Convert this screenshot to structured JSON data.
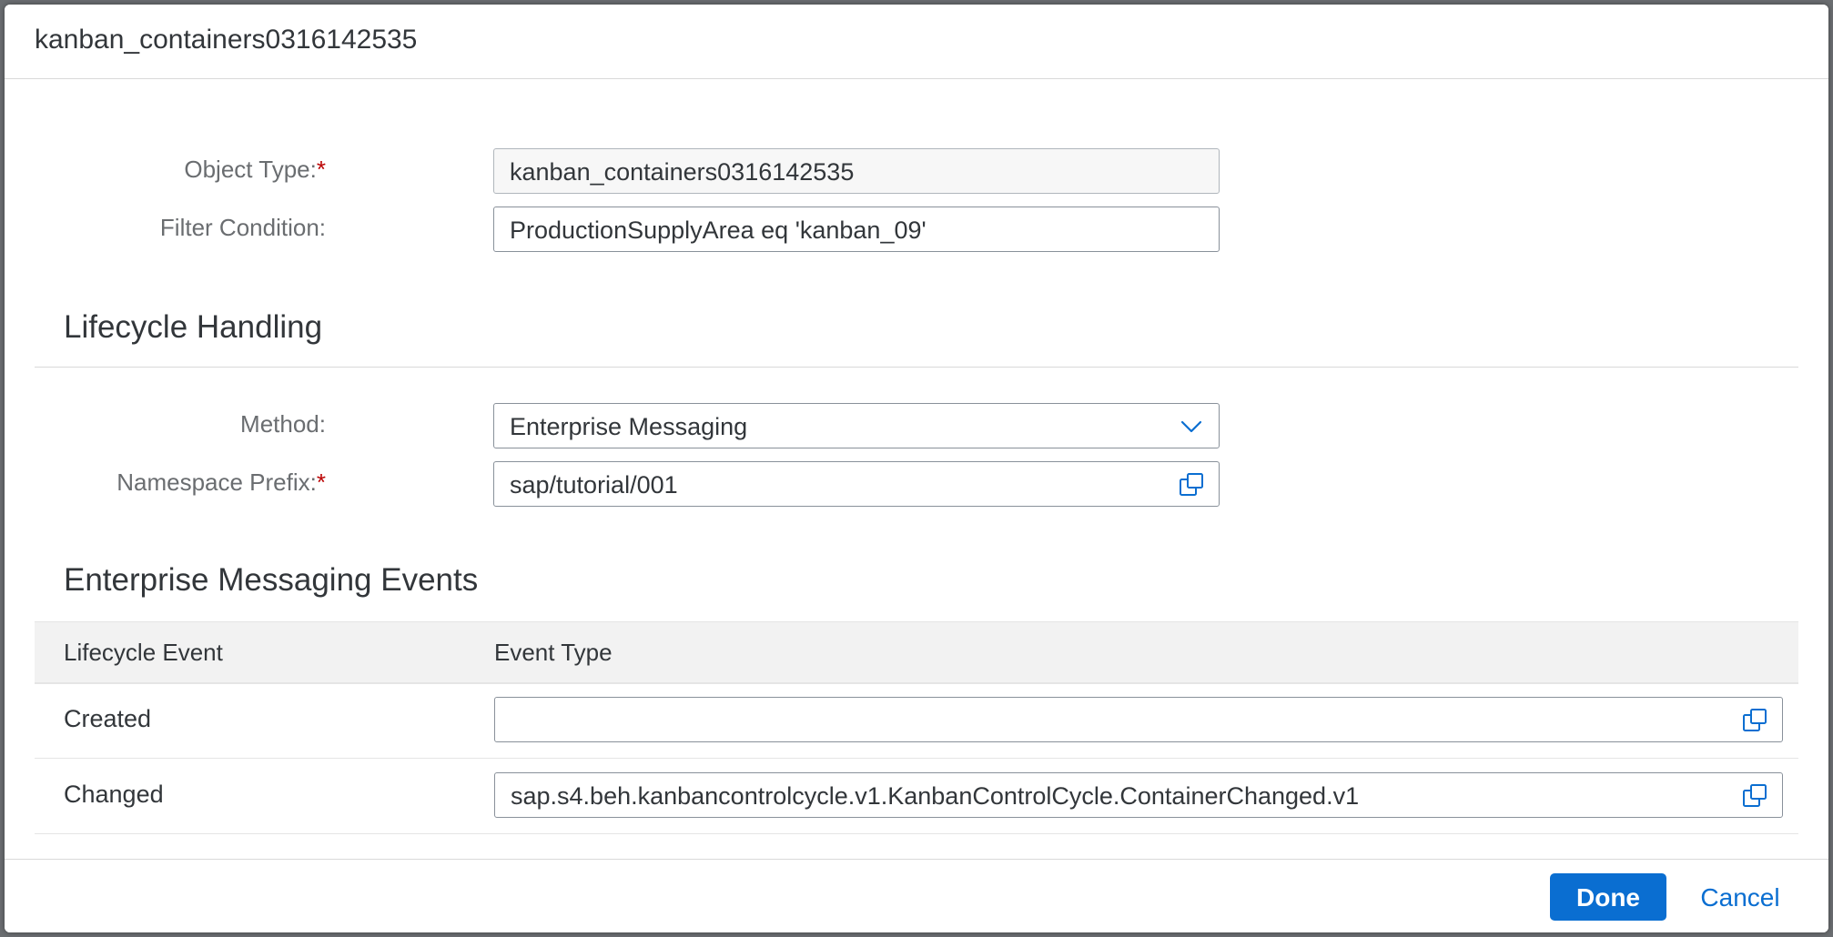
{
  "dialog": {
    "title": "kanban_containers0316142535"
  },
  "form": {
    "object_type_label": "Object Type:",
    "object_type_value": "kanban_containers0316142535",
    "filter_condition_label": "Filter Condition:",
    "filter_condition_value": "ProductionSupplyArea eq 'kanban_09'",
    "required_marker": "*"
  },
  "lifecycle": {
    "section_title": "Lifecycle Handling",
    "method_label": "Method:",
    "method_value": "Enterprise Messaging",
    "namespace_label": "Namespace Prefix:",
    "namespace_value": "sap/tutorial/001"
  },
  "events": {
    "section_title": "Enterprise Messaging Events",
    "columns": [
      "Lifecycle Event",
      "Event Type"
    ],
    "rows": [
      {
        "event": "Created",
        "type": ""
      },
      {
        "event": "Changed",
        "type": "sap.s4.beh.kanbancontrolcycle.v1.KanbanControlCycle.ContainerChanged.v1"
      }
    ]
  },
  "footer": {
    "done_label": "Done",
    "cancel_label": "Cancel"
  },
  "colors": {
    "accent": "#0a6ed1",
    "required": "#bb0000"
  },
  "icons": {
    "method_dropdown": "chevron-down-icon",
    "value_help": "value-help-icon"
  }
}
